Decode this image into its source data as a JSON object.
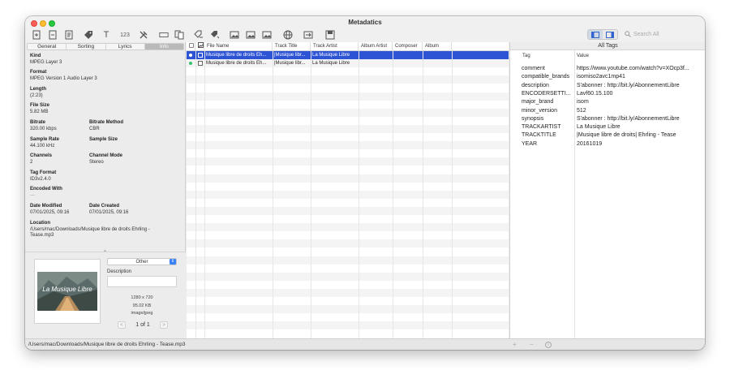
{
  "window": {
    "title": "Metadatics"
  },
  "toolbar": {
    "icons": [
      "import-file-icon",
      "export-file-icon",
      "file-icon",
      "tag-icon",
      "text-icon",
      "number-icon",
      "tools-icon",
      "label-icon",
      "copy-files-icon",
      "rename-icon",
      "auto-tag-icon",
      "artwork-icon",
      "artwork-add-icon",
      "artwork-remove-icon",
      "web-icon",
      "image-convert-icon",
      "save-icon"
    ],
    "search_placeholder": "Search All"
  },
  "left_tabs": [
    "General",
    "Sorting",
    "Lyrics",
    "Info"
  ],
  "left_tabs_active": 3,
  "info": {
    "kind_label": "Kind",
    "kind": "MPEG Layer 3",
    "format_label": "Format",
    "format": "MPEG Version 1 Audio Layer 3",
    "length_label": "Length",
    "length": "(2:23)",
    "filesize_label": "File Size",
    "filesize": "5.82 MB",
    "bitrate_label": "Bitrate",
    "bitrate": "320.00 kbps",
    "bitrate_method_label": "Bitrate Method",
    "bitrate_method": "CBR",
    "samplerate_label": "Sample Rate",
    "samplerate": "44.100 kHz",
    "samplesize_label": "Sample Size",
    "samplesize": "",
    "channels_label": "Channels",
    "channels": "2",
    "channelmode_label": "Channel Mode",
    "channelmode": "Stereo",
    "tagformat_label": "Tag Format",
    "tagformat": "ID3v2.4.0",
    "encodedwith_label": "Encoded With",
    "encodedwith": "---",
    "datemodified_label": "Date Modified",
    "datemodified": "07/01/2025, 09:16",
    "datecreated_label": "Date Created",
    "datecreated": "07/01/2025, 09:16",
    "location_label": "Location",
    "location": "/Users/mac/Downloads/Musique libre de droits Ehrling - Tease.mp3"
  },
  "artwork": {
    "image_text": "La Musique Libre",
    "type_select": "Other",
    "description_label": "Description",
    "dimensions": "1280 x 720",
    "size": "95.02 KB",
    "mime": "image/jpeg",
    "pager": "1 of 1",
    "prev": "<",
    "next": ">"
  },
  "table": {
    "headers": [
      "File Name",
      "Track Title",
      "Track Artist",
      "Album Artist",
      "Composer",
      "Album"
    ],
    "rows": [
      {
        "file": "Musique libre de droits Eh...",
        "title": "|Musique libr...",
        "artist": "La Musique Libre",
        "selected": true
      },
      {
        "file": "Musique libre de droits Eh...",
        "title": "|Musique libr...",
        "artist": "La Musique Libre",
        "selected": false
      }
    ]
  },
  "all_tags": {
    "title": "All Tags",
    "tag_header": "Tag",
    "value_header": "Value",
    "rows": [
      {
        "k": "comment",
        "v": "https://www.youtube.com/watch?v=XOcp3f..."
      },
      {
        "k": "compatible_brands",
        "v": "isomiso2avc1mp41"
      },
      {
        "k": "description",
        "v": "S'abonner : http://bit.ly/AbonnementLibre"
      },
      {
        "k": "ENCODERSETTI...",
        "v": "Lavf60.15.100"
      },
      {
        "k": "major_brand",
        "v": "isom"
      },
      {
        "k": "minor_version",
        "v": "512"
      },
      {
        "k": "synopsis",
        "v": "S'abonner : http://bit.ly/AbonnementLibre"
      },
      {
        "k": "TRACKARTIST",
        "v": "La Musique Libre"
      },
      {
        "k": "TRACKTITLE",
        "v": "|Musique libre de droits| Ehrling - Tease"
      },
      {
        "k": "YEAR",
        "v": "20161019"
      }
    ]
  },
  "status": {
    "path": "/Users/mac/Downloads/Musique libre de droits Ehrling - Tease.mp3",
    "add": "+",
    "remove": "−",
    "info": "i"
  }
}
